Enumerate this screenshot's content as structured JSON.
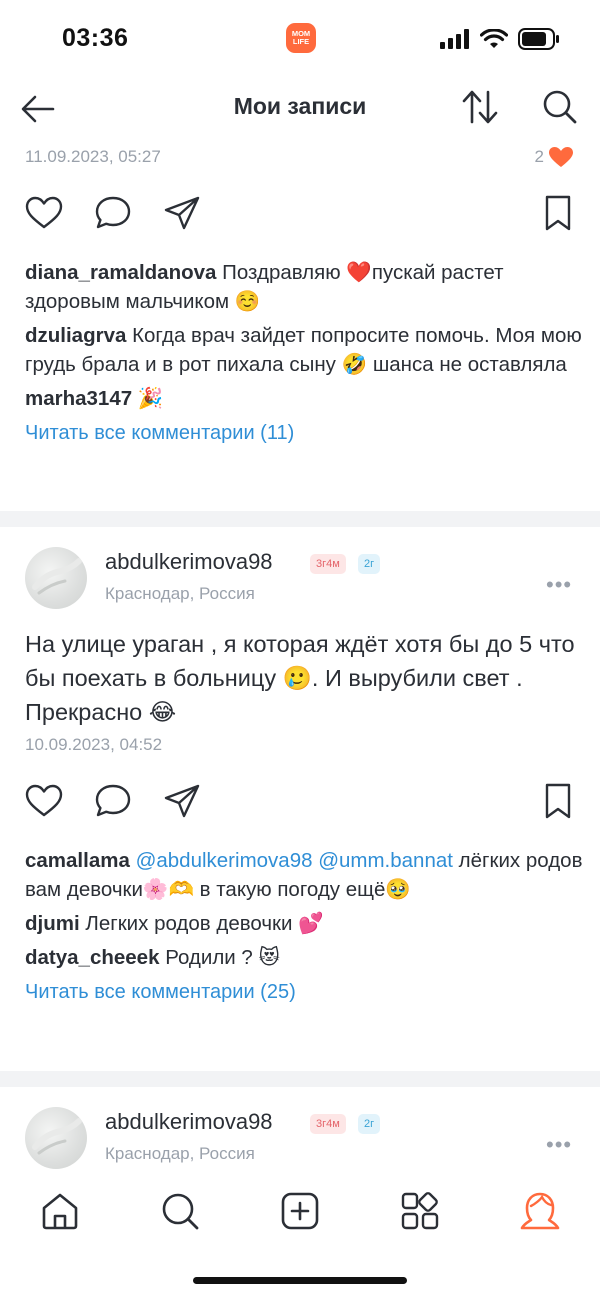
{
  "status_bar": {
    "time": "03:36",
    "app_badge": "MOM LIFE"
  },
  "header": {
    "title": "Мои записи"
  },
  "post1": {
    "date": "11.09.2023, 05:27",
    "likes": "2",
    "comments": [
      {
        "user": "diana_ramaldanova",
        "text": "Поздравляю ❤️пускай растет здоровым мальчиком ☺️"
      },
      {
        "user": "dzuliagrva",
        "text": "Когда врач зайдет попросите помочь. Моя мою грудь брала и в рот пихала сыну 🤣 шанса не оставляла"
      },
      {
        "user": "marha3147",
        "text": "🎉"
      }
    ],
    "read_all": "Читать все комментарии (11)"
  },
  "post2": {
    "username": "abdulkerimova98",
    "badge_age": "3г4м",
    "badge_child": "2г",
    "location": "Краснодар, Россия",
    "text": "На улице ураган , я которая ждёт хотя бы до 5 что бы поехать в больницу 🥲. И вырубили свет . Прекрасно 😂",
    "date": "10.09.2023, 04:52",
    "comments": [
      {
        "user": "camallama",
        "mention": "@abdulkerimova98 @umm.bannat",
        "text": "лёгких родов вам девочки🌸🫶 в такую погоду ещё🥹"
      },
      {
        "user": "djumi",
        "text": "Легких родов девочки 💕"
      },
      {
        "user": "datya_cheeek",
        "text": "Родили ? 😻"
      }
    ],
    "read_all": "Читать все комментарии (25)"
  },
  "post3": {
    "username": "abdulkerimova98",
    "badge_age": "3г4м",
    "badge_child": "2г",
    "location": "Краснодар, Россия"
  },
  "colors": {
    "accent": "#ff6a3d",
    "link": "#2f8ed6",
    "muted": "#9aa1ab",
    "text": "#2b2f36"
  }
}
